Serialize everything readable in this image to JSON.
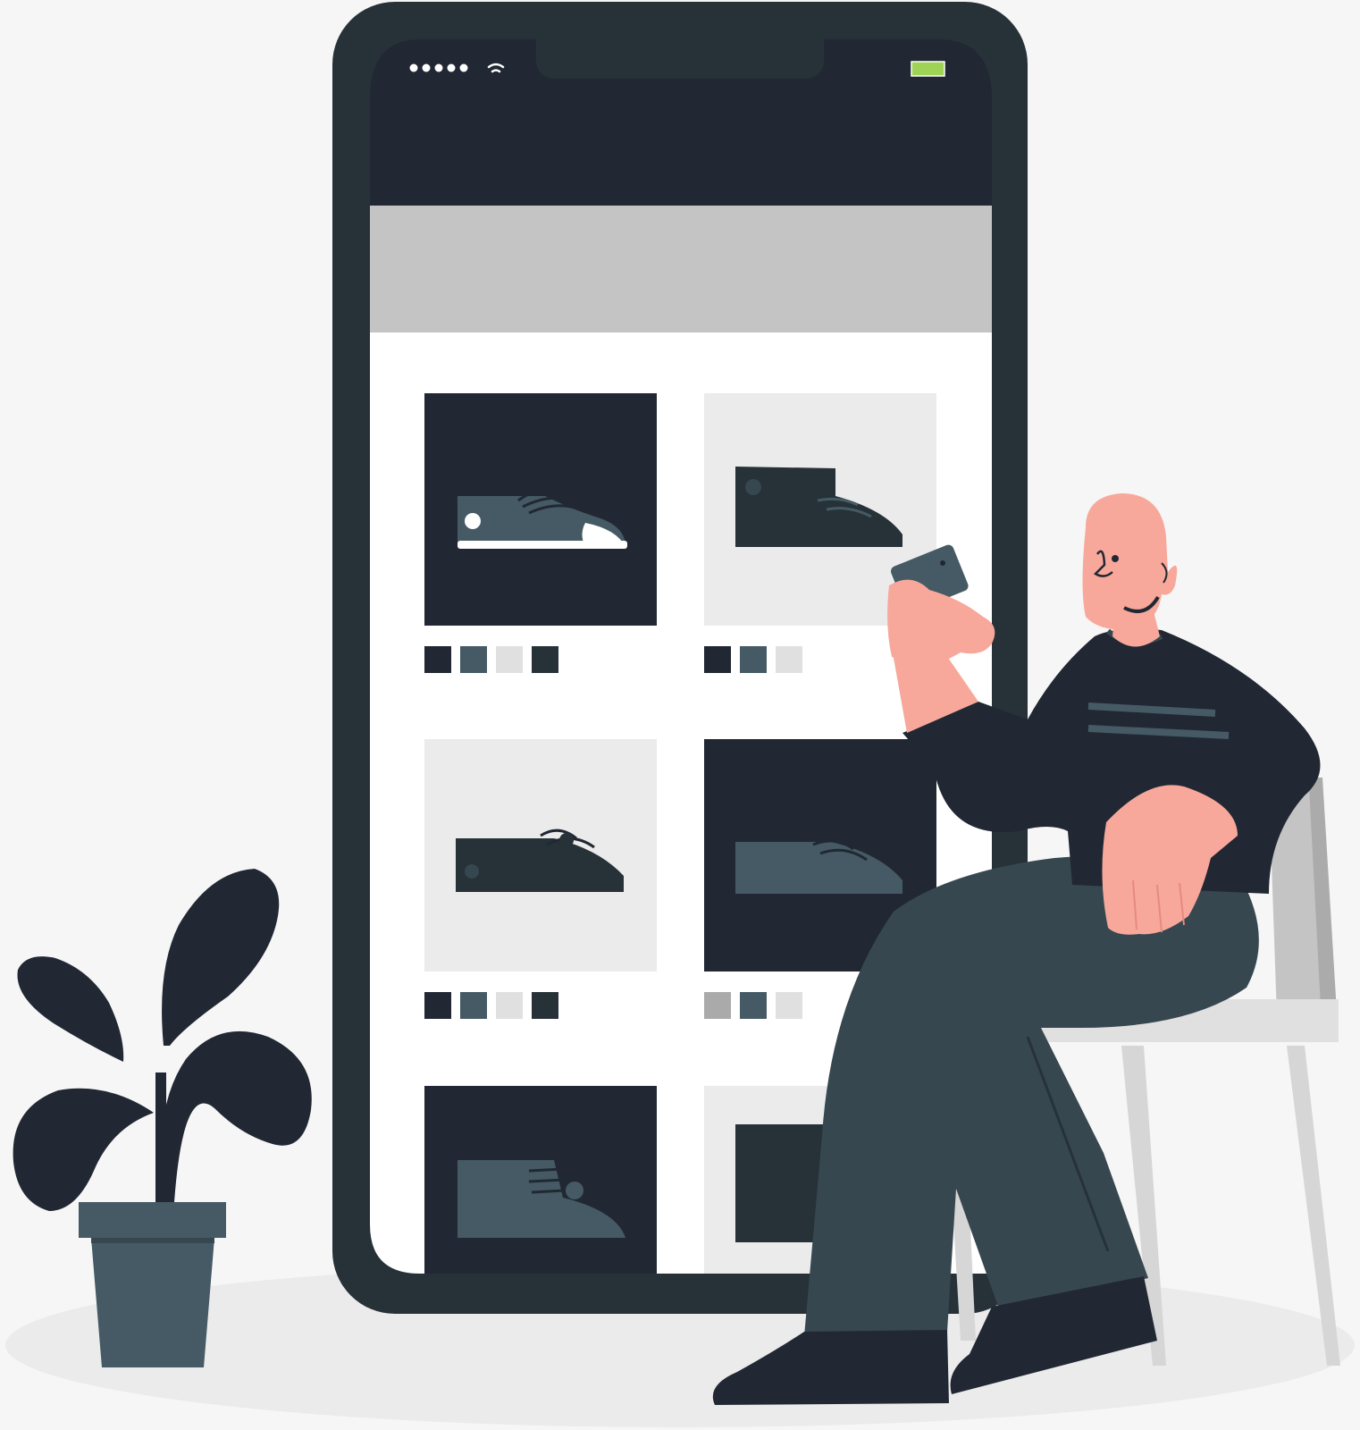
{
  "colors": {
    "background": "#f6f6f6",
    "ground": "#ebebeb",
    "phone_frame": "#263238",
    "screen_header": "#212833",
    "banner": "#c4c4c4",
    "screen_body": "#ffffff",
    "tile_dark": "#212833",
    "tile_light": "#ebebeb",
    "shoe_slate": "#455a64",
    "battery": "#9fd356",
    "skin": "#f7a89b",
    "sweater": "#212833",
    "trousers": "#37474f",
    "chair_seat": "#e0e0e0",
    "chair_legs": "#d6d6d6",
    "chair_back": "#ababab",
    "pot": "#455a64",
    "plant": "#212833"
  },
  "icons": {
    "signal": "signal-dots-icon",
    "wifi": "wifi-icon",
    "battery": "battery-icon"
  },
  "product_grid": {
    "tiles": [
      {
        "name": "tile-1",
        "theme": "dark",
        "shoe": "sneaker-white-toe",
        "swatches": [
          "#212833",
          "#455a64",
          "#e0e0e0",
          "#263238"
        ]
      },
      {
        "name": "tile-2",
        "theme": "light",
        "shoe": "high-top-boot",
        "swatches": [
          "#212833",
          "#455a64",
          "#e0e0e0"
        ]
      },
      {
        "name": "tile-3",
        "theme": "light",
        "shoe": "low-sneaker",
        "swatches": [
          "#212833",
          "#455a64",
          "#e0e0e0",
          "#263238"
        ]
      },
      {
        "name": "tile-4",
        "theme": "dark",
        "shoe": "slate-loafer",
        "swatches": [
          "#aaaaaa",
          "#455a64",
          "#e0e0e0"
        ]
      },
      {
        "name": "tile-5",
        "theme": "dark",
        "shoe": "slate-high-top",
        "swatches": []
      },
      {
        "name": "tile-6",
        "theme": "light",
        "shoe": "dark-boot",
        "swatches": []
      }
    ]
  }
}
